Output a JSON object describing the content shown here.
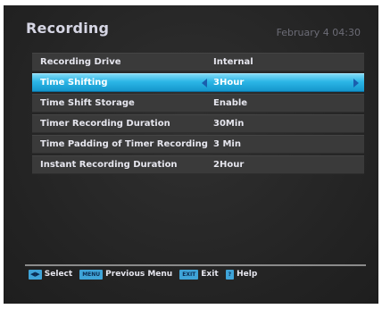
{
  "header": {
    "title": "Recording",
    "datetime": "February 4 04:30"
  },
  "menu": {
    "rows": [
      {
        "label": "Recording Drive",
        "value": "Internal"
      },
      {
        "label": "Time Shifting",
        "value": "3Hour",
        "selected": true
      },
      {
        "label": "Time Shift Storage",
        "value": "Enable"
      },
      {
        "label": "Timer Recording Duration",
        "value": "30Min"
      },
      {
        "label": "Time Padding of Timer Recording",
        "value": "3 Min"
      },
      {
        "label": "Instant Recording Duration",
        "value": "2Hour"
      }
    ]
  },
  "footer": {
    "select_key": "◀▶",
    "select_label": "Select",
    "menu_key": "MENU",
    "menu_label": "Previous Menu",
    "exit_key": "EXIT",
    "exit_label": "Exit",
    "help_key": "?",
    "help_label": "Help"
  },
  "colors": {
    "highlight": "#2bb6e6",
    "key_bg": "#3fa4d8",
    "row_bg": "#3a3a3a"
  }
}
